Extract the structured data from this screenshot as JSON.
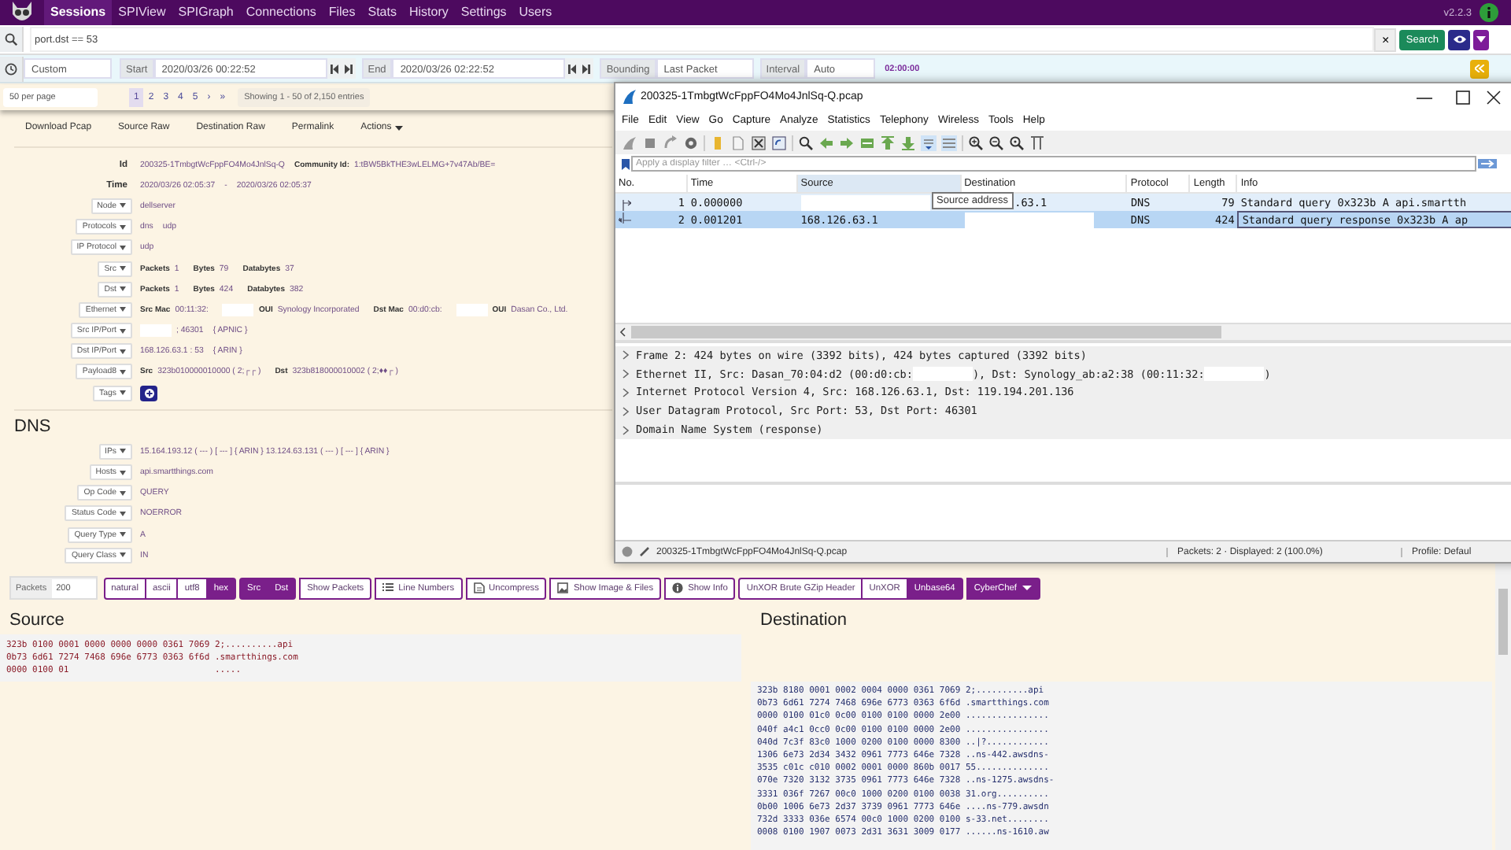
{
  "nav": {
    "items": [
      {
        "label": "Sessions",
        "selected": true
      },
      {
        "label": "SPIView",
        "selected": false
      },
      {
        "label": "SPIGraph",
        "selected": false
      },
      {
        "label": "Connections",
        "selected": false
      },
      {
        "label": "Files",
        "selected": false
      },
      {
        "label": "Stats",
        "selected": false
      },
      {
        "label": "History",
        "selected": false
      },
      {
        "label": "Settings",
        "selected": false
      },
      {
        "label": "Users",
        "selected": false
      }
    ],
    "version": "v2.2.3"
  },
  "search": {
    "value": "port.dst == 53",
    "clear": "×",
    "button": "Search"
  },
  "time_bar": {
    "range": "Custom",
    "start_label": "Start",
    "start": "2020/03/26 00:22:52",
    "end_label": "End",
    "end": "2020/03/26 02:22:52",
    "bounding_label": "Bounding",
    "bounding": "Last Packet",
    "interval_label": "Interval",
    "interval": "Auto",
    "duration": "02:00:00"
  },
  "paging": {
    "per_page": "50 per page",
    "pages": [
      {
        "label": "1",
        "selected": true
      },
      {
        "label": "2",
        "selected": false
      },
      {
        "label": "3",
        "selected": false
      },
      {
        "label": "4",
        "selected": false
      },
      {
        "label": "5",
        "selected": false
      }
    ],
    "next": "›",
    "last": "»",
    "info": "Showing 1 - 50 of 2,150 entries"
  },
  "session": {
    "links": [
      "Download Pcap",
      "Source Raw",
      "Destination Raw",
      "Permalink"
    ],
    "actions": "Actions",
    "fields": [
      {
        "kind": "plain",
        "label": "Id",
        "parts": [
          {
            "kind": "value",
            "text": "200325-1TmbgtWcFppFO4Mo4JnlSq-Q"
          },
          {
            "kind": "key",
            "text": "Community Id:"
          },
          {
            "kind": "value",
            "text": "1:tBW5BkTHE3wLELMG+7v47Ab/BE="
          }
        ]
      },
      {
        "kind": "plain",
        "label": "Time",
        "parts": [
          {
            "kind": "value",
            "text": "2020/03/26 02:05:37"
          },
          {
            "kind": "value",
            "text": "-"
          },
          {
            "kind": "value",
            "text": "2020/03/26 02:05:37"
          }
        ]
      },
      {
        "kind": "dropdown",
        "label": "Node",
        "parts": [
          {
            "kind": "value",
            "text": "dellserver"
          }
        ]
      },
      {
        "kind": "dropdown",
        "label": "Protocols",
        "parts": [
          {
            "kind": "value",
            "text": "dns"
          },
          {
            "kind": "value",
            "text": "udp"
          }
        ]
      },
      {
        "kind": "dropdown",
        "label": "IP Protocol",
        "parts": [
          {
            "kind": "value",
            "text": "udp"
          }
        ]
      },
      {
        "kind": "dropdown",
        "label": "Src",
        "parts": [
          {
            "kind": "key",
            "text": "Packets"
          },
          {
            "kind": "value",
            "text": "1"
          },
          {
            "kind": "key",
            "text": "Bytes"
          },
          {
            "kind": "value",
            "text": "79"
          },
          {
            "kind": "key",
            "text": "Databytes"
          },
          {
            "kind": "value",
            "text": "37"
          }
        ]
      },
      {
        "kind": "dropdown",
        "label": "Dst",
        "parts": [
          {
            "kind": "key",
            "text": "Packets"
          },
          {
            "kind": "value",
            "text": "1"
          },
          {
            "kind": "key",
            "text": "Bytes"
          },
          {
            "kind": "value",
            "text": "424"
          },
          {
            "kind": "key",
            "text": "Databytes"
          },
          {
            "kind": "value",
            "text": "382"
          }
        ]
      },
      {
        "kind": "dropdown",
        "label": "Ethernet",
        "parts": [
          {
            "kind": "key",
            "text": "Src Mac"
          },
          {
            "kind": "value",
            "text": "00:11:32:"
          },
          {
            "kind": "redacted"
          },
          {
            "kind": "key",
            "text": "OUI"
          },
          {
            "kind": "value",
            "text": "Synology Incorporated"
          },
          {
            "kind": "key",
            "text": "Dst Mac"
          },
          {
            "kind": "value",
            "text": "00:d0:cb:"
          },
          {
            "kind": "redacted"
          },
          {
            "kind": "key",
            "text": "OUI"
          },
          {
            "kind": "value",
            "text": "Dasan Co., Ltd."
          }
        ]
      },
      {
        "kind": "dropdown",
        "label": "Src IP/Port",
        "parts": [
          {
            "kind": "redacted"
          },
          {
            "kind": "value",
            "text": "; 46301"
          },
          {
            "kind": "value",
            "text": "{ APNIC }"
          }
        ]
      },
      {
        "kind": "dropdown",
        "label": "Dst IP/Port",
        "parts": [
          {
            "kind": "value",
            "text": "168.126.63.1 : 53"
          },
          {
            "kind": "value",
            "text": "{ ARIN }"
          }
        ]
      },
      {
        "kind": "dropdown",
        "label": "Payload8",
        "parts": [
          {
            "kind": "key",
            "text": "Src"
          },
          {
            "kind": "value",
            "text": "323b010000010000 ( 2;┌┌ )"
          },
          {
            "kind": "key",
            "text": "Dst"
          },
          {
            "kind": "value",
            "text": "323b818000010002 ( 2;♦♦┌ )"
          }
        ]
      },
      {
        "kind": "dropdown",
        "label": "Tags",
        "parts": [
          {
            "kind": "add"
          }
        ]
      }
    ],
    "dns_title": "DNS",
    "dns_fields": [
      {
        "kind": "dropdown",
        "label": "IPs",
        "parts": [
          {
            "kind": "value",
            "text": "15.164.193.12 ( --- ) [ --- ] { ARIN } 13.124.63.131 ( --- ) [ --- ] { ARIN }"
          }
        ]
      },
      {
        "kind": "dropdown",
        "label": "Hosts",
        "parts": [
          {
            "kind": "value",
            "text": "api.smartthings.com"
          }
        ]
      },
      {
        "kind": "dropdown",
        "label": "Op Code",
        "parts": [
          {
            "kind": "value",
            "text": "QUERY"
          }
        ]
      },
      {
        "kind": "dropdown",
        "label": "Status Code",
        "parts": [
          {
            "kind": "value",
            "text": "NOERROR"
          }
        ]
      },
      {
        "kind": "dropdown",
        "label": "Query Type",
        "parts": [
          {
            "kind": "value",
            "text": "A"
          }
        ]
      },
      {
        "kind": "dropdown",
        "label": "Query Class",
        "parts": [
          {
            "kind": "value",
            "text": "IN"
          }
        ]
      }
    ]
  },
  "payload_toolbar": {
    "packets_label": "Packets",
    "packets": "200",
    "buttons": [
      {
        "label": "natural",
        "selected": false
      },
      {
        "label": "ascii",
        "selected": false
      },
      {
        "label": "utf8",
        "selected": false
      },
      {
        "label": "hex",
        "selected": true
      },
      {
        "label": "Src",
        "selected": true
      },
      {
        "label": "Dst",
        "selected": true
      },
      {
        "label": "Show Packets",
        "selected": false
      },
      {
        "label": "Line Numbers",
        "selected": false
      },
      {
        "label": "Uncompress",
        "selected": false
      },
      {
        "label": "Show Image & Files",
        "selected": false
      },
      {
        "label": "Show Info",
        "selected": false
      },
      {
        "label": "UnXOR Brute GZip Header",
        "selected": false
      },
      {
        "label": "UnXOR",
        "selected": false
      },
      {
        "label": "Unbase64",
        "selected": true
      },
      {
        "label": "CyberChef",
        "selected": true
      }
    ]
  },
  "panes": [
    {
      "title": "Source",
      "lines": [
        "323b 0100 0001 0000 0000 0000 0361 7069 2;..........api",
        "0b73 6d61 7274 7468 696e 6773 0363 6f6d .smartthings.com",
        "0000 0100 01                            ....."
      ]
    },
    {
      "title": "Destination",
      "lines": [
        "323b 8180 0001 0002 0004 0000 0361 7069 2;..........api",
        "0b73 6d61 7274 7468 696e 6773 0363 6f6d .smartthings.com",
        "0000 0100 01c0 0c00 0100 0100 0000 2e00 ................",
        "040f a4c1 0cc0 0c00 0100 0100 0000 2e00 ................",
        "040d 7c3f 83c0 1000 0200 0100 0000 8300 ..|?............",
        "1306 6e73 2d34 3432 0961 7773 646e 7328 ..ns-442.awsdns-",
        "3535 c01c c010 0002 0001 0000 860b 0017 55..............",
        "070e 7320 3132 3735 0961 7773 646e 7328 ..ns-1275.awsdns-",
        "3331 036f 7267 00c0 1000 0200 0100 0038 31.org..........",
        "0b00 1006 6e73 2d37 3739 0961 7773 646e ....ns-779.awsdn",
        "732d 3333 036e 6574 00c0 1000 0200 0100 s-33.net........",
        "0008 0100 1907 0073 2d31 3631 3009 0177 ......ns-1610.aw"
      ]
    }
  ],
  "capture_window": {
    "title": "200325-1TmbgtWcFppFO4Mo4JnlSq-Q.pcap",
    "menu": [
      "File",
      "Edit",
      "View",
      "Go",
      "Capture",
      "Analyze",
      "Statistics",
      "Telephony",
      "Wireless",
      "Tools",
      "Help"
    ],
    "filter_placeholder": "Apply a display filter … <Ctrl-/>",
    "columns": [
      "No.",
      "Time",
      "Source",
      "Destination",
      "Protocol",
      "Length",
      "Info"
    ],
    "packets": [
      {
        "selected": false,
        "no": "1",
        "time": "0.000000",
        "destination": ".63.1",
        "protocol": "DNS",
        "length": "79",
        "info": "Standard query 0x323b A api.smartth"
      },
      {
        "selected": true,
        "no": "2",
        "time": "0.001201",
        "source": "168.126.63.1",
        "protocol": "DNS",
        "length": "424",
        "info": "Standard query response 0x323b A ap"
      }
    ],
    "tooltip": "Source address",
    "details": [
      [
        {
          "kind": "text",
          "text": "Frame 2: 424 bytes on wire (3392 bits), 424 bytes captured (3392 bits)"
        }
      ],
      [
        {
          "kind": "text",
          "text": "Ethernet II, Src: Dasan_70:04:d2 (00:d0:cb:"
        },
        {
          "kind": "redacted"
        },
        {
          "kind": "text",
          "text": "), Dst: Synology_ab:a2:38 (00:11:32:"
        },
        {
          "kind": "redacted"
        },
        {
          "kind": "text",
          "text": ")"
        }
      ],
      [
        {
          "kind": "text",
          "text": "Internet Protocol Version 4, Src: 168.126.63.1, Dst: 119.194.201.136"
        }
      ],
      [
        {
          "kind": "text",
          "text": "User Datagram Protocol, Src Port: 53, Dst Port: 46301"
        }
      ],
      [
        {
          "kind": "text",
          "text": "Domain Name System (response)"
        }
      ]
    ],
    "status": {
      "file": "200325-1TmbgtWcFppFO4Mo4JnlSq-Q.pcap",
      "packets": "Packets: 2 · Displayed: 2 (100.0%)",
      "profile": "Profile: Defaul"
    }
  }
}
